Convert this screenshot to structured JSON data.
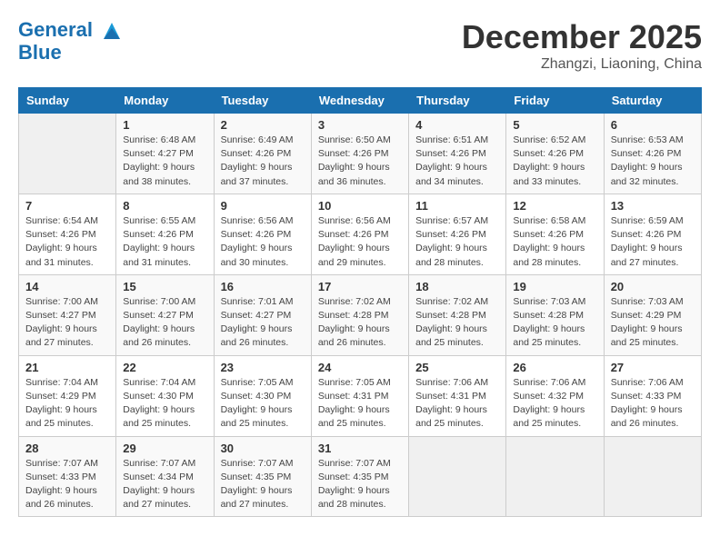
{
  "header": {
    "logo_line1": "General",
    "logo_line2": "Blue",
    "month": "December 2025",
    "location": "Zhangzi, Liaoning, China"
  },
  "weekdays": [
    "Sunday",
    "Monday",
    "Tuesday",
    "Wednesday",
    "Thursday",
    "Friday",
    "Saturday"
  ],
  "weeks": [
    [
      {
        "day": "",
        "info": ""
      },
      {
        "day": "1",
        "info": "Sunrise: 6:48 AM\nSunset: 4:27 PM\nDaylight: 9 hours\nand 38 minutes."
      },
      {
        "day": "2",
        "info": "Sunrise: 6:49 AM\nSunset: 4:26 PM\nDaylight: 9 hours\nand 37 minutes."
      },
      {
        "day": "3",
        "info": "Sunrise: 6:50 AM\nSunset: 4:26 PM\nDaylight: 9 hours\nand 36 minutes."
      },
      {
        "day": "4",
        "info": "Sunrise: 6:51 AM\nSunset: 4:26 PM\nDaylight: 9 hours\nand 34 minutes."
      },
      {
        "day": "5",
        "info": "Sunrise: 6:52 AM\nSunset: 4:26 PM\nDaylight: 9 hours\nand 33 minutes."
      },
      {
        "day": "6",
        "info": "Sunrise: 6:53 AM\nSunset: 4:26 PM\nDaylight: 9 hours\nand 32 minutes."
      }
    ],
    [
      {
        "day": "7",
        "info": "Sunrise: 6:54 AM\nSunset: 4:26 PM\nDaylight: 9 hours\nand 31 minutes."
      },
      {
        "day": "8",
        "info": "Sunrise: 6:55 AM\nSunset: 4:26 PM\nDaylight: 9 hours\nand 31 minutes."
      },
      {
        "day": "9",
        "info": "Sunrise: 6:56 AM\nSunset: 4:26 PM\nDaylight: 9 hours\nand 30 minutes."
      },
      {
        "day": "10",
        "info": "Sunrise: 6:56 AM\nSunset: 4:26 PM\nDaylight: 9 hours\nand 29 minutes."
      },
      {
        "day": "11",
        "info": "Sunrise: 6:57 AM\nSunset: 4:26 PM\nDaylight: 9 hours\nand 28 minutes."
      },
      {
        "day": "12",
        "info": "Sunrise: 6:58 AM\nSunset: 4:26 PM\nDaylight: 9 hours\nand 28 minutes."
      },
      {
        "day": "13",
        "info": "Sunrise: 6:59 AM\nSunset: 4:26 PM\nDaylight: 9 hours\nand 27 minutes."
      }
    ],
    [
      {
        "day": "14",
        "info": "Sunrise: 7:00 AM\nSunset: 4:27 PM\nDaylight: 9 hours\nand 27 minutes."
      },
      {
        "day": "15",
        "info": "Sunrise: 7:00 AM\nSunset: 4:27 PM\nDaylight: 9 hours\nand 26 minutes."
      },
      {
        "day": "16",
        "info": "Sunrise: 7:01 AM\nSunset: 4:27 PM\nDaylight: 9 hours\nand 26 minutes."
      },
      {
        "day": "17",
        "info": "Sunrise: 7:02 AM\nSunset: 4:28 PM\nDaylight: 9 hours\nand 26 minutes."
      },
      {
        "day": "18",
        "info": "Sunrise: 7:02 AM\nSunset: 4:28 PM\nDaylight: 9 hours\nand 25 minutes."
      },
      {
        "day": "19",
        "info": "Sunrise: 7:03 AM\nSunset: 4:28 PM\nDaylight: 9 hours\nand 25 minutes."
      },
      {
        "day": "20",
        "info": "Sunrise: 7:03 AM\nSunset: 4:29 PM\nDaylight: 9 hours\nand 25 minutes."
      }
    ],
    [
      {
        "day": "21",
        "info": "Sunrise: 7:04 AM\nSunset: 4:29 PM\nDaylight: 9 hours\nand 25 minutes."
      },
      {
        "day": "22",
        "info": "Sunrise: 7:04 AM\nSunset: 4:30 PM\nDaylight: 9 hours\nand 25 minutes."
      },
      {
        "day": "23",
        "info": "Sunrise: 7:05 AM\nSunset: 4:30 PM\nDaylight: 9 hours\nand 25 minutes."
      },
      {
        "day": "24",
        "info": "Sunrise: 7:05 AM\nSunset: 4:31 PM\nDaylight: 9 hours\nand 25 minutes."
      },
      {
        "day": "25",
        "info": "Sunrise: 7:06 AM\nSunset: 4:31 PM\nDaylight: 9 hours\nand 25 minutes."
      },
      {
        "day": "26",
        "info": "Sunrise: 7:06 AM\nSunset: 4:32 PM\nDaylight: 9 hours\nand 25 minutes."
      },
      {
        "day": "27",
        "info": "Sunrise: 7:06 AM\nSunset: 4:33 PM\nDaylight: 9 hours\nand 26 minutes."
      }
    ],
    [
      {
        "day": "28",
        "info": "Sunrise: 7:07 AM\nSunset: 4:33 PM\nDaylight: 9 hours\nand 26 minutes."
      },
      {
        "day": "29",
        "info": "Sunrise: 7:07 AM\nSunset: 4:34 PM\nDaylight: 9 hours\nand 27 minutes."
      },
      {
        "day": "30",
        "info": "Sunrise: 7:07 AM\nSunset: 4:35 PM\nDaylight: 9 hours\nand 27 minutes."
      },
      {
        "day": "31",
        "info": "Sunrise: 7:07 AM\nSunset: 4:35 PM\nDaylight: 9 hours\nand 28 minutes."
      },
      {
        "day": "",
        "info": ""
      },
      {
        "day": "",
        "info": ""
      },
      {
        "day": "",
        "info": ""
      }
    ]
  ]
}
